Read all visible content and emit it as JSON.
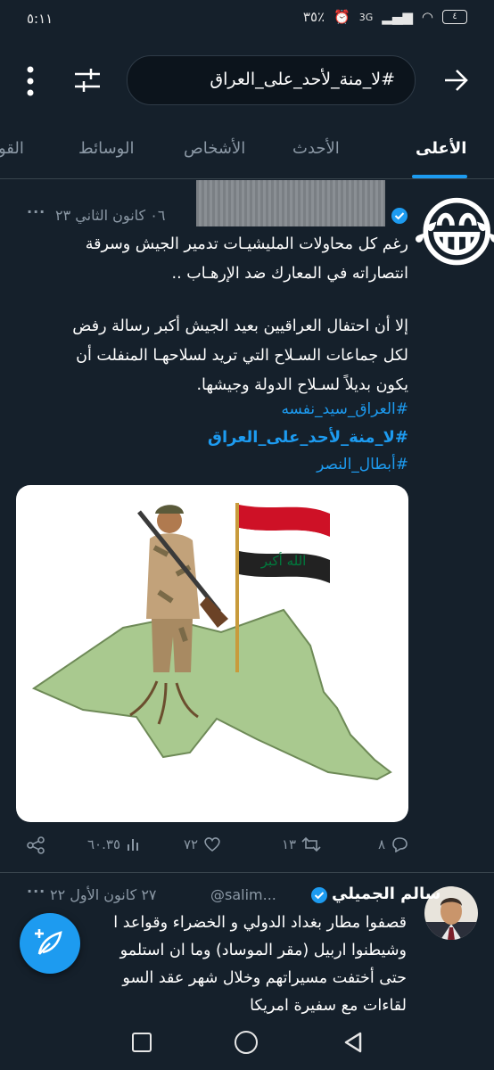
{
  "status_bar": {
    "time": "٥:١١",
    "battery_percent": "٣٥٪",
    "network": "3G",
    "battery_level": "٤"
  },
  "search": {
    "query": "#لا_منة_لأحد_على_العراق"
  },
  "tabs": [
    {
      "label": "الأعلى",
      "active": true
    },
    {
      "label": "الأحدث",
      "active": false
    },
    {
      "label": "الأشخاص",
      "active": false
    },
    {
      "label": "الوسائط",
      "active": false
    },
    {
      "label": "القو",
      "active": false
    }
  ],
  "tweet1": {
    "date": "٠٦ كانون الثاني ٢٣",
    "more": "...",
    "text1_line1": "رغم كل محاولات المليشيـات تدمير الجيش وسرقة",
    "text1_line2": "انتصاراته في المعارك ضد الإرهـاب ..",
    "text2_line1": "إلا أن احتفال العراقيين بعيد الجيش أكبر رسالة رفض",
    "text2_line2": "لكل جماعات السـلاح التي تريد لسلاحهـا المنفلت أن",
    "text2_line3": "يكون بديلاً لسـلاح الدولة وجيشها.",
    "hashtags": [
      "#العراق_سيد_نفسه",
      "#لا_منة_لأحد_على_العراق",
      "#أبطال_النصر"
    ],
    "media_flag_text": "الله أكبر",
    "actions": {
      "replies": "٨",
      "retweets": "١٣",
      "likes": "٧٢",
      "views": "٦٠.٣٥"
    },
    "emoji": "😂"
  },
  "tweet2": {
    "name": "سالم الجميلي",
    "handle": "@salim...",
    "date": "٢٧ كانون الأول ٢٢",
    "line1": "قصفوا مطار بغداد الدولي و الخضراء وقواعد ا",
    "line2": "وشيطنوا اربيل (مقر الموساد) وما ان استلمو",
    "line3": "حتى أختفت مسيراتهم وخلال شهر عقد السو",
    "line4": "لقاءات مع سفيرة امريكا"
  },
  "colors": {
    "background": "#15202b",
    "accent": "#1d9bf0",
    "muted": "#8b98a5",
    "divider": "#38444d"
  }
}
